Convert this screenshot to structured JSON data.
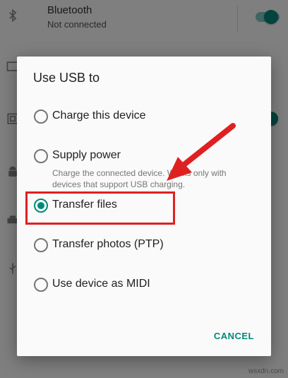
{
  "background": {
    "bluetooth": {
      "title": "Bluetooth",
      "subtitle": "Not connected",
      "icon": "bluetooth-icon",
      "toggle_on": true
    },
    "rows": [
      {
        "icon": "cast-icon"
      },
      {
        "icon": "nfc-icon"
      },
      {
        "icon": "android-icon"
      },
      {
        "icon": "printer-icon"
      },
      {
        "icon": "usb-icon"
      }
    ]
  },
  "dialog": {
    "title": "Use USB to",
    "options": [
      {
        "label": "Charge this device",
        "checked": false
      },
      {
        "label": "Supply power",
        "checked": false,
        "description": "Charge the connected device. Works only with devices that support USB charging."
      },
      {
        "label": "Transfer files",
        "checked": true
      },
      {
        "label": "Transfer photos (PTP)",
        "checked": false
      },
      {
        "label": "Use device as MIDI",
        "checked": false
      }
    ],
    "cancel_label": "CANCEL"
  },
  "colors": {
    "accent": "#00897b",
    "annotation": "#e02020"
  },
  "watermark": "wsxdn.com"
}
